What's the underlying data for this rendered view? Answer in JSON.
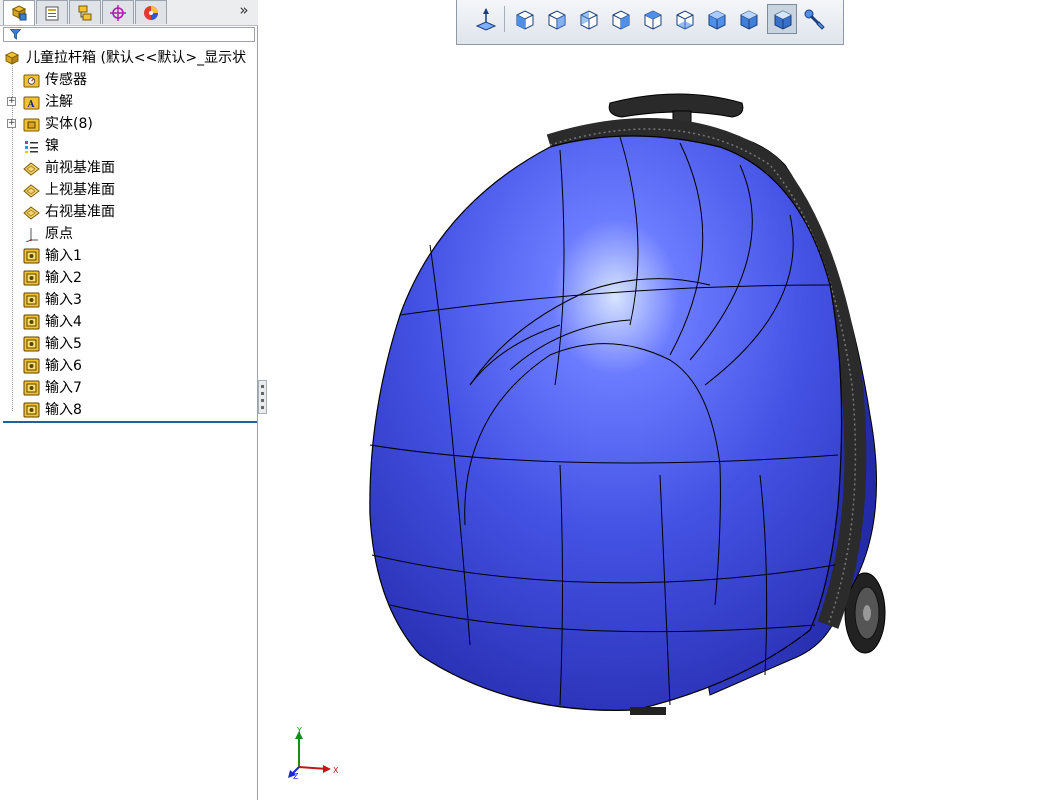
{
  "panel": {
    "tabs": [
      {
        "name": "feature-manager",
        "icon": "feature-manager-icon"
      },
      {
        "name": "property-manager",
        "icon": "property-manager-icon"
      },
      {
        "name": "configuration-manager",
        "icon": "configuration-manager-icon"
      },
      {
        "name": "dim-xpert-manager",
        "icon": "dimxpert-icon"
      },
      {
        "name": "display-manager",
        "icon": "display-manager-icon"
      }
    ],
    "more": "»",
    "tree": {
      "root": "儿童拉杆箱 (默认<<默认>_显示状",
      "items": [
        {
          "label": "传感器",
          "icon": "sensor-folder-icon",
          "expandable": false
        },
        {
          "label": "注解",
          "icon": "annotations-folder-icon",
          "expandable": true
        },
        {
          "label": "实体(8)",
          "icon": "solid-bodies-folder-icon",
          "expandable": true
        },
        {
          "label": "镍",
          "icon": "material-icon",
          "expandable": false
        },
        {
          "label": "前视基准面",
          "icon": "plane-icon",
          "expandable": false
        },
        {
          "label": "上视基准面",
          "icon": "plane-icon",
          "expandable": false
        },
        {
          "label": "右视基准面",
          "icon": "plane-icon",
          "expandable": false
        },
        {
          "label": "原点",
          "icon": "origin-icon",
          "expandable": false
        },
        {
          "label": "输入1",
          "icon": "imported-body-icon",
          "expandable": false
        },
        {
          "label": "输入2",
          "icon": "imported-body-icon",
          "expandable": false
        },
        {
          "label": "输入3",
          "icon": "imported-body-icon",
          "expandable": false
        },
        {
          "label": "输入4",
          "icon": "imported-body-icon",
          "expandable": false
        },
        {
          "label": "输入5",
          "icon": "imported-body-icon",
          "expandable": false
        },
        {
          "label": "输入6",
          "icon": "imported-body-icon",
          "expandable": false
        },
        {
          "label": "输入7",
          "icon": "imported-body-icon",
          "expandable": false
        },
        {
          "label": "输入8",
          "icon": "imported-body-icon",
          "expandable": false
        }
      ]
    }
  },
  "viewbar": {
    "buttons": [
      {
        "name": "normal-to-button",
        "icon": "normal-to-icon"
      },
      {
        "name": "view-front-button",
        "icon": "front-view-icon"
      },
      {
        "name": "view-back-button",
        "icon": "back-view-icon"
      },
      {
        "name": "view-left-button",
        "icon": "left-view-icon"
      },
      {
        "name": "view-right-button",
        "icon": "right-view-icon"
      },
      {
        "name": "view-top-button",
        "icon": "top-view-icon"
      },
      {
        "name": "view-bottom-button",
        "icon": "bottom-view-icon"
      },
      {
        "name": "view-isometric-button",
        "icon": "isometric-view-icon"
      },
      {
        "name": "view-trimetric-button",
        "icon": "trimetric-view-icon"
      },
      {
        "name": "view-dimetric-button",
        "icon": "dimetric-view-icon",
        "active": true
      },
      {
        "name": "view-selector-button",
        "icon": "view-selector-icon"
      }
    ]
  },
  "viewport": {
    "model_color": "#4a56e0",
    "triad": {
      "x": "X",
      "y": "Y",
      "z": "Z"
    }
  }
}
